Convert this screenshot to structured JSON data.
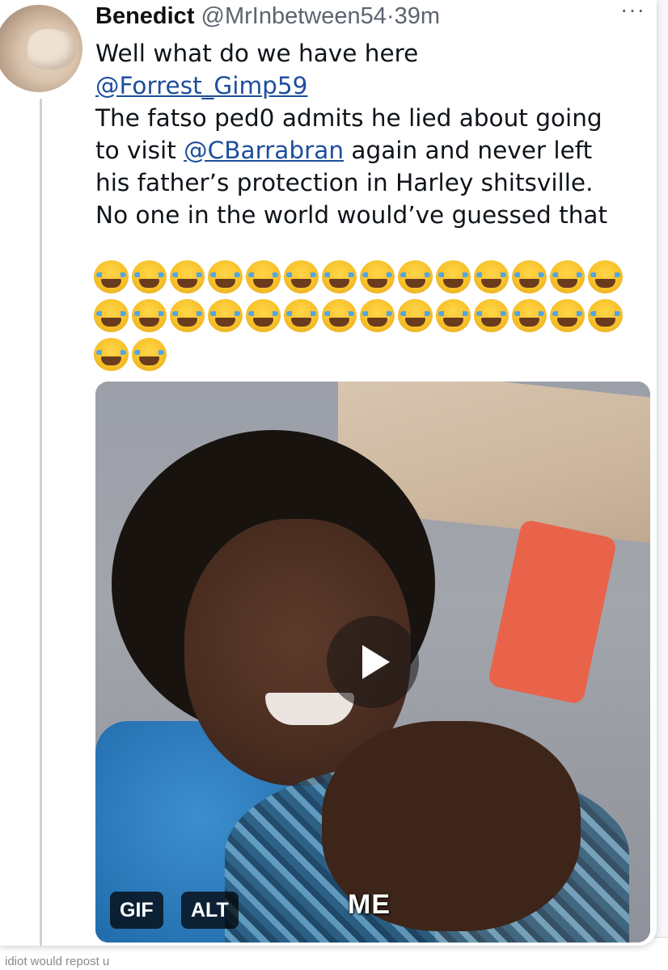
{
  "tweet": {
    "author_name": "Benedict",
    "handle": "@MrInbetween54",
    "separator": "·",
    "time": "39m",
    "more_label": "···",
    "lines": {
      "l1": "Well what do we have here",
      "l2_mention": "@Forrest_Gimp59",
      "l3": "The fatso ped0 admits he lied about going",
      "l4_pre": "to visit ",
      "l4_mention": "@CBarrabran",
      "l4_post": " again and never left",
      "l5": "his father’s protection in Harley shitsville.",
      "l6": "No one in the world would’ve guessed that"
    },
    "emoji": {
      "name": "face-with-tears-of-joy-icon",
      "count": 30
    }
  },
  "media": {
    "badge_gif": "GIF",
    "badge_alt": "ALT",
    "caption": "ME",
    "play_icon": "play-icon"
  },
  "background": {
    "bottom_text": "idiot would repost u"
  }
}
